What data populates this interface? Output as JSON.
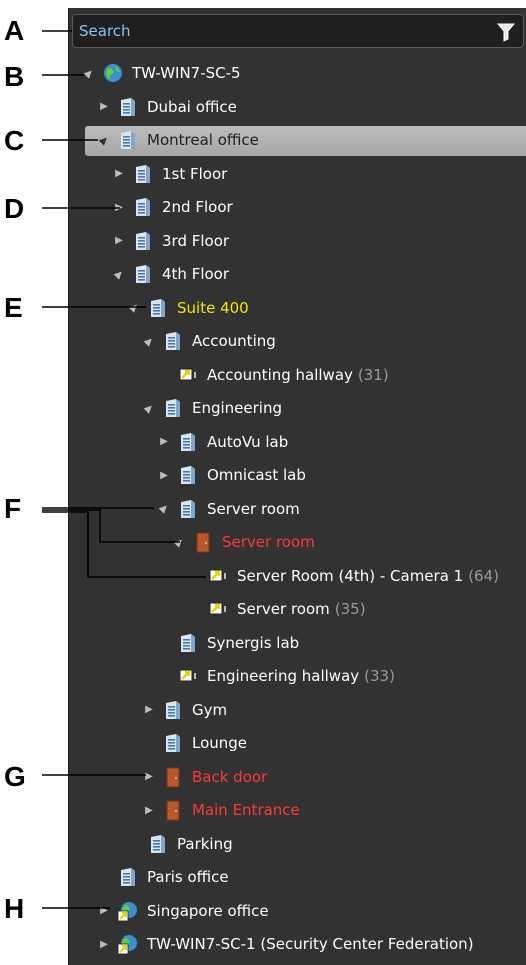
{
  "search": {
    "placeholder": "Search"
  },
  "callouts": {
    "a": "A",
    "b": "B",
    "c": "C",
    "d": "D",
    "e": "E",
    "f": "F",
    "g": "G",
    "h": "H"
  },
  "tree": [
    {
      "label": "TW-WIN7-SC-5",
      "expander": "▲",
      "icon": "globe",
      "indent": 0
    },
    {
      "label": "Dubai office",
      "expander": "▶",
      "icon": "building",
      "indent": 1
    },
    {
      "label": "Montreal office",
      "expander": "▲",
      "icon": "building",
      "indent": 1,
      "selected": true
    },
    {
      "label": "1st Floor",
      "expander": "▶",
      "icon": "building",
      "indent": 2
    },
    {
      "label": "2nd Floor",
      "expander": "▶",
      "icon": "building",
      "indent": 2
    },
    {
      "label": "3rd Floor",
      "expander": "▶",
      "icon": "building",
      "indent": 2
    },
    {
      "label": "4th Floor",
      "expander": "▲",
      "icon": "building",
      "indent": 2
    },
    {
      "label": "Suite 400",
      "expander": "▲",
      "icon": "building",
      "indent": 3,
      "color": "yellow"
    },
    {
      "label": "Accounting",
      "expander": "▲",
      "icon": "building",
      "indent": 4
    },
    {
      "label": "Accounting hallway",
      "count": "(31)",
      "expander": "",
      "icon": "camera",
      "indent": 5
    },
    {
      "label": "Engineering",
      "expander": "▲",
      "icon": "building",
      "indent": 4
    },
    {
      "label": "AutoVu lab",
      "expander": "▶",
      "icon": "building",
      "indent": 5
    },
    {
      "label": "Omnicast lab",
      "expander": "▶",
      "icon": "building",
      "indent": 5
    },
    {
      "label": "Server room",
      "expander": "▲",
      "icon": "building",
      "indent": 5
    },
    {
      "label": "Server room",
      "expander": "▲",
      "icon": "door",
      "indent": 6,
      "color": "red"
    },
    {
      "label": "Server Room (4th) - Camera 1",
      "count": "(64)",
      "expander": "",
      "icon": "camera",
      "indent": 7
    },
    {
      "label": "Server room",
      "count": "(35)",
      "expander": "",
      "icon": "camera",
      "indent": 7
    },
    {
      "label": "Synergis lab",
      "expander": "",
      "icon": "building",
      "indent": 5
    },
    {
      "label": "Engineering hallway",
      "count": "(33)",
      "expander": "",
      "icon": "camera",
      "indent": 5
    },
    {
      "label": "Gym",
      "expander": "▶",
      "icon": "building",
      "indent": 4
    },
    {
      "label": "Lounge",
      "expander": "",
      "icon": "building",
      "indent": 4
    },
    {
      "label": "Back door",
      "expander": "▶",
      "icon": "door",
      "indent": 4,
      "color": "red"
    },
    {
      "label": "Main Entrance",
      "expander": "▶",
      "icon": "door",
      "indent": 4,
      "color": "red"
    },
    {
      "label": "Parking",
      "expander": "",
      "icon": "building",
      "indent": 3
    },
    {
      "label": "Paris office",
      "expander": "",
      "icon": "building",
      "indent": 1
    },
    {
      "label": "Singapore office",
      "expander": "▶",
      "icon": "globe-linked",
      "indent": 1
    },
    {
      "label": "TW-WIN7-SC-1 (Security Center Federation)",
      "expander": "▶",
      "icon": "globe-linked",
      "indent": 1
    }
  ]
}
